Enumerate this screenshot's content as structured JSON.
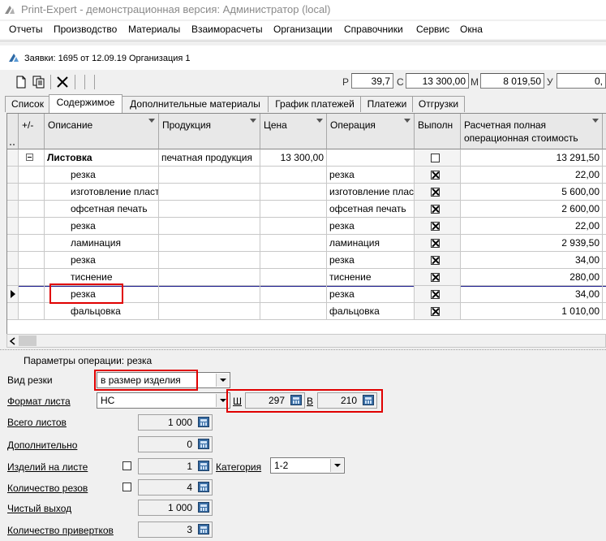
{
  "app": {
    "title": "Print-Expert - демонстрационная версия: Администратор (local)"
  },
  "menu": [
    "Отчеты",
    "Производство",
    "Материалы",
    "Взаиморасчеты",
    "Организации",
    "Справочники",
    "Сервис",
    "Окна"
  ],
  "document": {
    "title": "Заявки: 1695 от 12.09.19  Организация 1"
  },
  "toolbar": {
    "metrics": [
      {
        "label": "Р",
        "value": "39,7"
      },
      {
        "label": "С",
        "value": "13 300,00"
      },
      {
        "label": "М",
        "value": "8 019,50"
      },
      {
        "label": "У",
        "value": "0,"
      }
    ]
  },
  "tabs": [
    "Список",
    "Содержимое",
    "Дополнительные материалы",
    "График платежей",
    "Платежи",
    "Отгрузки"
  ],
  "active_tab": "Содержимое",
  "grid": {
    "headers": [
      "+/-",
      "Описание",
      "Продукция",
      "Цена",
      "Операция",
      "Выполн",
      "Расчетная полная операционная стоимость"
    ],
    "rows": [
      {
        "desc": "Листовка",
        "product": "печатная продукция",
        "price": "13 300,00",
        "op": "",
        "done": false,
        "cost": "13 291,50",
        "group": true
      },
      {
        "desc": "резка",
        "product": "",
        "price": "",
        "op": "резка",
        "done": true,
        "cost": "22,00"
      },
      {
        "desc": "изготовление пластин",
        "product": "",
        "price": "",
        "op": "изготовление пластин",
        "done": true,
        "cost": "5 600,00"
      },
      {
        "desc": "офсетная печать",
        "product": "",
        "price": "",
        "op": "офсетная печать",
        "done": true,
        "cost": "2 600,00"
      },
      {
        "desc": "резка",
        "product": "",
        "price": "",
        "op": "резка",
        "done": true,
        "cost": "22,00"
      },
      {
        "desc": "ламинация",
        "product": "",
        "price": "",
        "op": "ламинация",
        "done": true,
        "cost": "2 939,50"
      },
      {
        "desc": "резка",
        "product": "",
        "price": "",
        "op": "резка",
        "done": true,
        "cost": "34,00"
      },
      {
        "desc": "тиснение",
        "product": "",
        "price": "",
        "op": "тиснение",
        "done": true,
        "cost": "280,00"
      },
      {
        "desc": "резка",
        "product": "",
        "price": "",
        "op": "резка",
        "done": true,
        "cost": "34,00",
        "selected": true
      },
      {
        "desc": "фальцовка",
        "product": "",
        "price": "",
        "op": "фальцовка",
        "done": true,
        "cost": "1 010,00"
      }
    ]
  },
  "params": {
    "title": "Параметры операции: резка",
    "cut_type_label": "Вид резки",
    "cut_type_value": "в размер изделия",
    "sheet_format_label": "Формат листа",
    "sheet_format_value": "НС",
    "width_label": "Ш",
    "width_value": "297",
    "height_label": "В",
    "height_value": "210",
    "total_sheets_label": "Всего листов",
    "total_sheets_value": "1 000",
    "additional_label": "Дополнительно",
    "additional_value": "0",
    "items_per_sheet_label": "Изделий на листе",
    "items_per_sheet_value": "1",
    "category_label": "Категория",
    "category_value": "1-2",
    "cuts_count_label": "Количество резов",
    "cuts_count_value": "4",
    "net_output_label": "Чистый выход",
    "net_output_value": "1 000",
    "turns_count_label": "Количество привертков",
    "turns_count_value": "3"
  },
  "colors": {
    "highlight": "#e00000",
    "selected_row_border": "#1a1a8c"
  }
}
